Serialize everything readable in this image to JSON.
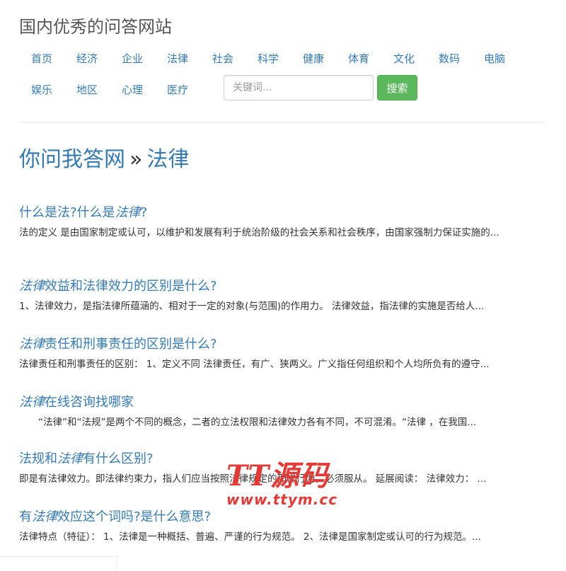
{
  "site_title": "国内优秀的问答网站",
  "nav_row1": [
    "首页",
    "经济",
    "企业",
    "法律",
    "社会",
    "科学",
    "健康",
    "体育",
    "文化",
    "数码",
    "电脑"
  ],
  "nav_row2": [
    "娱乐",
    "地区",
    "心理",
    "医疗"
  ],
  "search": {
    "placeholder": "关键词...",
    "button": "搜索"
  },
  "breadcrumb": {
    "site": "你问我答网",
    "sep": "»",
    "category": "法律"
  },
  "items": [
    {
      "title_pre": "什么是法?什么是",
      "title_em": "法律",
      "title_post": "?",
      "desc": "法的定义 是由国家制定或认可，以维护和发展有利于统治阶级的社会关系和社会秩序，由国家强制力保证实施的..."
    },
    {
      "title_pre": "",
      "title_em": "法律",
      "title_post": "效益和法律效力的区别是什么?",
      "desc": "1、法律效力，是指法律所蕴涵的、相对于一定的对象(与范围)的作用力。 法律效益，指法律的实施是否给人..."
    },
    {
      "title_pre": "",
      "title_em": "法律",
      "title_post": "责任和刑事责任的区别是什么?",
      "desc": "法律责任和刑事责任的区别： 1、定义不同 法律责任，有广、狭两义。广义指任何组织和个人均所负有的遵守..."
    },
    {
      "title_pre": "",
      "title_em": "法律",
      "title_post": "在线咨询找哪家",
      "desc": "　　“法律”和“法规”是两个不同的概念，二者的立法权限和法律效力各有不同，不可混淆。“法律 ，在我国..."
    },
    {
      "title_pre": "法规和",
      "title_em": "法律",
      "title_post": "有什么区别?",
      "desc": "即是有法律效力。即法律约束力，指人们应当按照法律规定的那样行为，必须服从。 延展阅读： 法律效力： ..."
    },
    {
      "title_pre": "有",
      "title_em": "法律",
      "title_post": "效应这个词吗?是什么意思?",
      "desc": "法律特点（特征）： 1、法律是一种概括、普遍、严谨的行为规范。 2、法律是国家制定或认可的行为规范。..."
    }
  ],
  "watermark": {
    "big": "TT源码",
    "small": "www.ttym.cc"
  }
}
